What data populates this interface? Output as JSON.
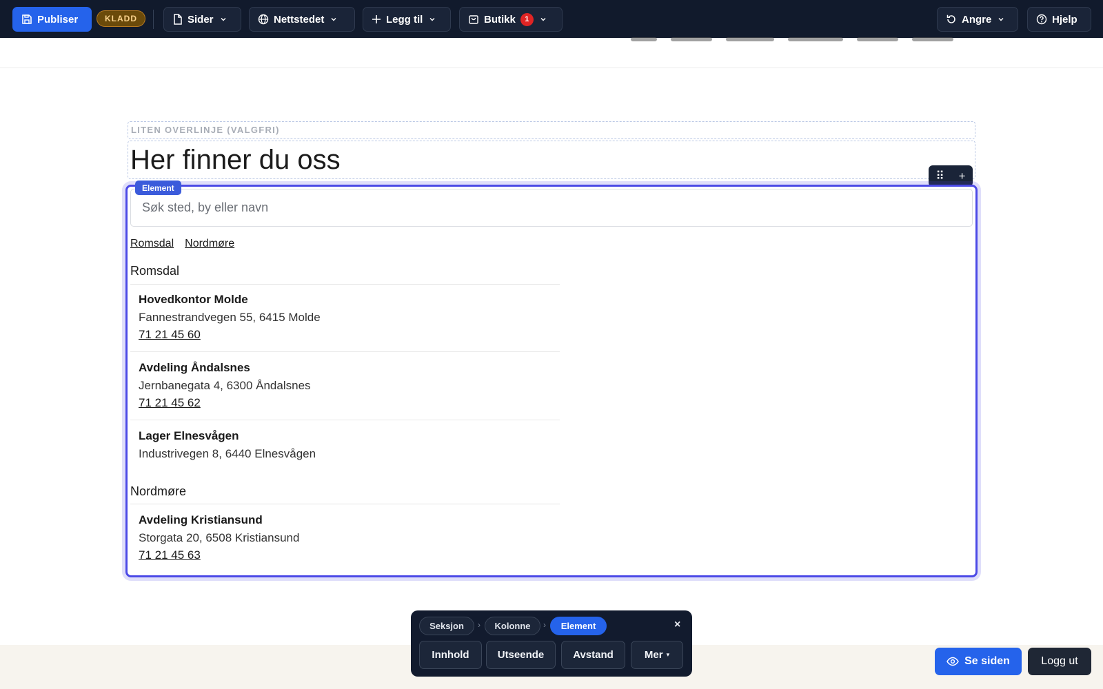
{
  "toolbar": {
    "publish_label": "Publiser",
    "draft_badge": "KLADD",
    "pages_label": "Sider",
    "site_label": "Nettstedet",
    "add_label": "Legg til",
    "shop_label": "Butikk",
    "shop_count": "1",
    "undo_label": "Angre",
    "help_label": "Hjelp"
  },
  "content": {
    "overline": "LITEN OVERLINJE (VALGFRI)",
    "heading": "Her finner du oss"
  },
  "element": {
    "tag": "Element",
    "search_placeholder": "Søk sted, by eller navn",
    "filters": [
      "Romsdal",
      "Nordmøre"
    ],
    "regions": [
      {
        "name": "Romsdal",
        "locations": [
          {
            "name": "Hovedkontor Molde",
            "address": "Fannestrandvegen 55, 6415 Molde",
            "phone": "71 21 45 60"
          },
          {
            "name": "Avdeling Åndalsnes",
            "address": "Jernbanegata 4, 6300 Åndalsnes",
            "phone": "71 21 45 62"
          },
          {
            "name": "Lager Elnesvågen",
            "address": "Industrivegen 8, 6440 Elnesvågen",
            "phone": ""
          }
        ]
      },
      {
        "name": "Nordmøre",
        "locations": [
          {
            "name": "Avdeling Kristiansund",
            "address": "Storgata 20, 6508 Kristiansund",
            "phone": "71 21 45 63"
          }
        ]
      }
    ]
  },
  "breadcrumb": {
    "items": [
      "Seksjon",
      "Kolonne",
      "Element"
    ],
    "active": "Element",
    "close": "×"
  },
  "panel_tabs": {
    "content": "Innhold",
    "appearance": "Utseende",
    "spacing": "Avstand",
    "more": "Mer"
  },
  "footer_actions": {
    "view_page": "Se siden",
    "logout": "Logg ut"
  },
  "colors": {
    "toolbar_bg": "#111a2c",
    "accent": "#2563eb",
    "selection": "#4b49e6",
    "badge_red": "#e02424"
  },
  "icons": {
    "publish": "save-icon",
    "pages": "file-icon",
    "site": "globe-icon",
    "add": "plus-icon",
    "shop": "bag-icon",
    "undo": "undo-icon",
    "help": "help-icon",
    "view": "eye-icon"
  }
}
